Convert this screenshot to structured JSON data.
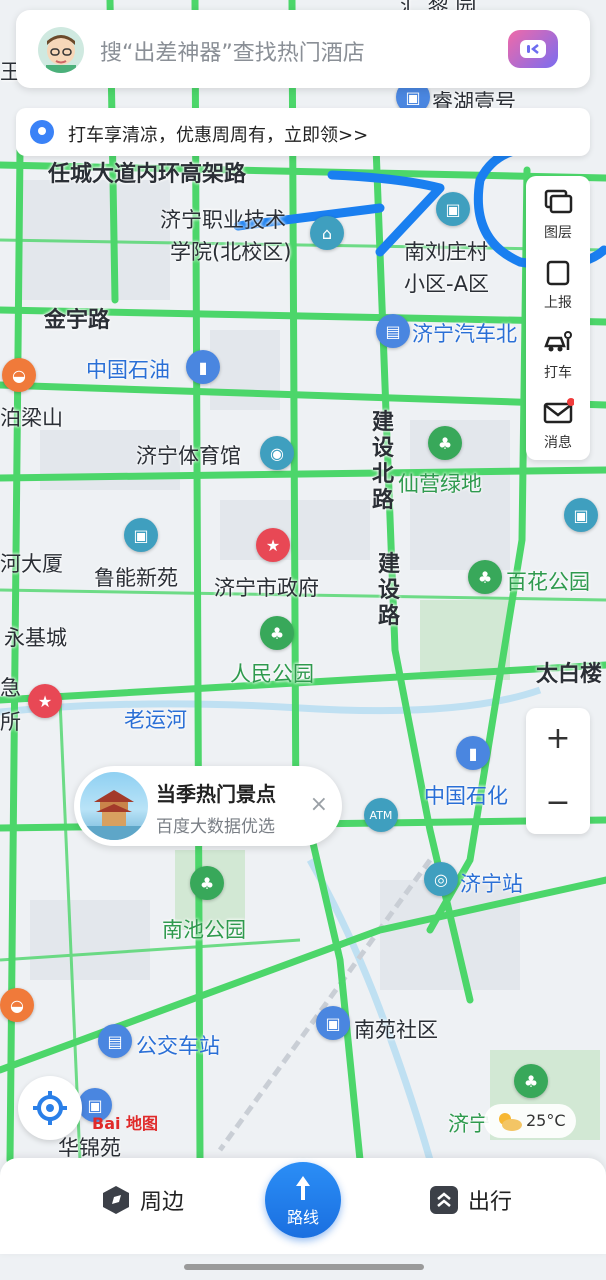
{
  "search": {
    "placeholder_text": "搜“出差神器”查找热门酒店"
  },
  "promo": {
    "text": "打车享清凉，优惠周周有，立即领>>"
  },
  "side_panel": {
    "items": [
      {
        "label": "图层",
        "icon": "layers-icon"
      },
      {
        "label": "上报",
        "icon": "report-icon"
      },
      {
        "label": "打车",
        "icon": "taxi-icon"
      },
      {
        "label": "消息",
        "icon": "message-icon"
      }
    ]
  },
  "zoom": {
    "in": "+",
    "out": "−"
  },
  "bubble": {
    "title": "当季热门景点",
    "subtitle": "百度大数据优选",
    "close": "×"
  },
  "brand": {
    "logo_text": "Bai 地图"
  },
  "weather": {
    "temp": "25°C"
  },
  "bottom_nav": {
    "nearby": "周边",
    "route": "路线",
    "travel": "出行"
  },
  "map_labels": {
    "top1": "汇 黎 园",
    "wang": "王",
    "ruihu": "睿湖壹号",
    "ring_road": "任城大道内环高架路",
    "college": "济宁职业技术",
    "college2": "学院(北校区)",
    "nanliu": "南刘庄村",
    "nanliu2": "小区-A区",
    "jinyu": "金宇路",
    "qiche": "济宁汽车北",
    "zhongshi": "中国石油",
    "liangshan": "泊梁山",
    "tiyuguan": "济宁体育馆",
    "jianshe_n": "建设北路",
    "xianying": "仙营绿地",
    "heda": "河大厦",
    "luneng": "鲁能新苑",
    "zhengfu": "济宁市政府",
    "jianshe": "建设路",
    "baihua": "百花公园",
    "yongji": "永基城",
    "renmin": "人民公园",
    "taibai": "太白楼",
    "laoyun": "老运河",
    "ji": "急",
    "suo": "所",
    "zhongshihua": "中国石化",
    "jining_station": "济宁站",
    "nanchi": "南池公园",
    "nanyuan": "南苑社区",
    "gongjiao": "公交车站",
    "huajin": "华锦苑",
    "jining2": "济宁"
  },
  "colors": {
    "road": "#4cd66a",
    "accent": "#1a6fe0",
    "annotation": "#1a7ff0"
  }
}
